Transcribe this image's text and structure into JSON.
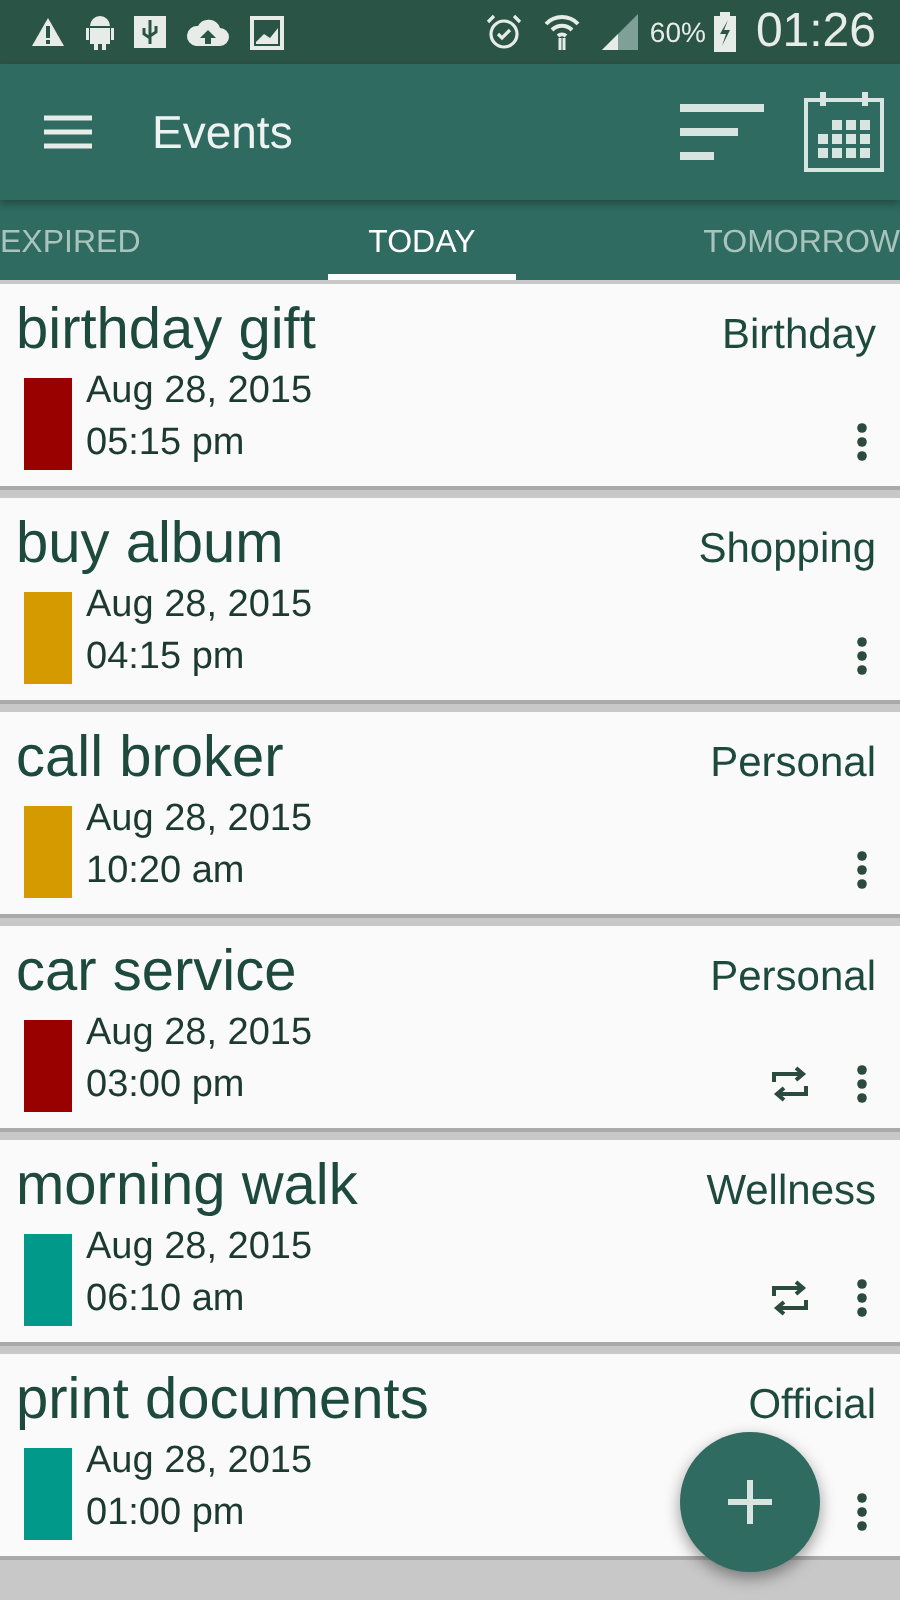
{
  "status_bar": {
    "battery": "60%",
    "time": "01:26"
  },
  "toolbar": {
    "title": "Events"
  },
  "tabs": [
    {
      "label": "EXPIRED",
      "selected": false
    },
    {
      "label": "TODAY",
      "selected": true
    },
    {
      "label": "TOMORROW",
      "selected": false
    }
  ],
  "events": [
    {
      "title": "birthday gift",
      "category": "Birthday",
      "date": "Aug 28, 2015",
      "time": "05:15 pm",
      "color": "#990000",
      "repeat": false
    },
    {
      "title": "buy album",
      "category": "Shopping",
      "date": "Aug 28, 2015",
      "time": "04:15 pm",
      "color": "#d49a00",
      "repeat": false
    },
    {
      "title": "call broker",
      "category": "Personal",
      "date": "Aug 28, 2015",
      "time": "10:20 am",
      "color": "#d49a00",
      "repeat": false
    },
    {
      "title": "car service",
      "category": "Personal",
      "date": "Aug 28, 2015",
      "time": "03:00 pm",
      "color": "#990000",
      "repeat": true
    },
    {
      "title": "morning walk",
      "category": "Wellness",
      "date": "Aug 28, 2015",
      "time": "06:10 am",
      "color": "#00998a",
      "repeat": true
    },
    {
      "title": "print documents",
      "category": "Official",
      "date": "Aug 28, 2015",
      "time": "01:00 pm",
      "color": "#00998a",
      "repeat": false
    }
  ]
}
